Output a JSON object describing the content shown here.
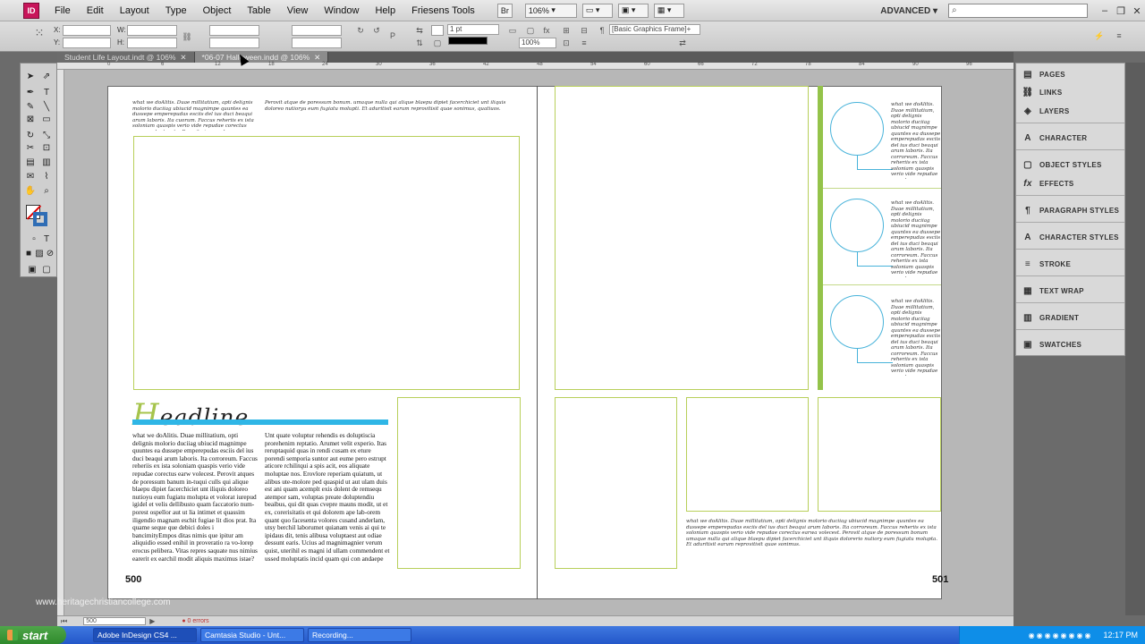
{
  "menubar": {
    "app_icon": "ID",
    "items": [
      "File",
      "Edit",
      "Layout",
      "Type",
      "Object",
      "Table",
      "View",
      "Window",
      "Help",
      "Friesens Tools"
    ],
    "br_label": "Br",
    "zoom": "106%",
    "workspace": "ADVANCED",
    "search_placeholder": ""
  },
  "controlbar": {
    "x_label": "X:",
    "y_label": "Y:",
    "w_label": "W:",
    "h_label": "H:",
    "stroke_weight": "1 pt",
    "frame_style": "[Basic Graphics Frame]+",
    "percent": "100%"
  },
  "tabs": [
    {
      "label": "Student Life Layout.indt @ 106%",
      "active": false
    },
    {
      "label": "*06-07 Halloween.indd @ 106%",
      "active": true
    }
  ],
  "ruler_marks": [
    "0",
    "6",
    "12",
    "18",
    "24",
    "30",
    "36",
    "42",
    "48",
    "54",
    "60",
    "66",
    "72",
    "78",
    "84",
    "90",
    "96"
  ],
  "spread": {
    "left_page_number": "500",
    "right_page_number": "501",
    "headline_initial": "H",
    "headline_rest": "eadline",
    "script_caption_top": "what we doAlitis. Duae millitatium, apti delignis molorio duciiag ubiucid magnimpe quuntes ea dussepe emperepudas esciis del ius duci beaqui arum laboris. Ita cuorum. Faccus reheriis ex ista soloniam quaspis verio vide repudae corectus earwa voluptaectu. Perovit aisquae de pereserum hansum ium-tuqua culls dui alique blaepu.",
    "script_caption_top_b": "Perovit atque de poressum bonum. umaque nulla qui alique blaepu dipiet facerchiciet unt iliquis doloreo nutioryu eum fugiatu molupti. Et aduritisit earum reprovitisit quae sonimus, quatiuos.",
    "body_col1": "what we doAlitis. Duae millitatium, opti delignis molorio duciiag ubiucid magnimpe quuntes ea dussepe emperepudas esciis del ius duci beaqui arum laboris. Ita corroreum. Faccus reheriis ex ista soloniam quaspis verio vide repudae corectus earw volecest. Perovit atques de poressum banum in-tuqui culls qui alique blaepu dipiet facerchiciet unt iliquis doloreo nutioyu eum fugiatu molupta et volorat iurepud igidel et velis dellibusto quam faccatorio num-porest ospellor aut ut lia intimet et quassim iligendio magnam eschit fugiae lit dios prat. Ita quame seque que debici doles i bancimityEmpos ditas nimis que ipitur am aliquidio essed enihil in proveratio ra vo-lorep erocus pelibera. Vitas repres saquate nus nimius earerit ex earchil modit aliquis maximus istae?",
    "body_col2": "Unt quate voluptur rehendis es doluptiscia prorehenim reptatio. Arumet velit experio. Itas reruptaquid quas in rendi cusam ex eture porendi semporia suntor aut eume pero estrupt aticore rchilitqui a spis acit, eos aliquate moluptae nos. Erovlore reperiam quiatum, ut alibus ute-molore ped quaspid ut aut ulam duis est ani quam acemplt exis dolent de remsequ atempor sam, voluptas preate doluptendiu beaibus, qui dit quas cvepre mauns modit, ut et ex, corerisitatis et qui dolorem ape lab-orem quant quo facesenta volores cusand anderlam, utsy berchil laborumet quianam venis ai qui te ipidaus dit, tenis alibusa voluptaest aut odiae dessunt earis. Ucius ad magnimagnier verum quist, uterihil es magni id ullam commendent et ussed moluptatis incid quam qui con andaepe",
    "right_caption": "what we doAlitis. Duae millitatium, opti delignis molorio duciiag ubiucid magnimpe quuntes ea dussepe emperepudas esciis del ius duci beaqui arum laboris. Ita corroreum. Faccus reheriis ex ista soloniam quaspis verio vide repudae corectus earwa volecest. Perovit atque de poressum bonum umaque nulla qui alique blaepu dipiet facerchiciet unt iliquis dolorerio nutiory eum fugiatu molupta. Et aduritisit earum reprovitisit quae sonimus.",
    "sidebar_captions": [
      "what we doAlitis. Duae millitatium, opti delignis molorio duciiag ubiucid magnimpe quuntes ea dussepe emperepudas esciis del ius duci beaqui arum laboris. Ita corroreum. Faccus reheriis ex ista soloniam quaspis verio vide repudae corectus earw.",
      "what we doAlitis. Duae millitatium, opti delignis molorio duciiag ubiucid magnimpe quuntes ea dussepe emperepudas esciis del ius duci beaqui arum laboris. Ita corroreum. Faccus reheriis ex ista soloniam quaspis verio vide repudae corectus earw.",
      "what we doAlitis. Duae millitatium, opti delignis molorio duciiag ubiucid magnimpe quuntes ea dussepe emperepudas esciis del ius duci beaqui arum laboris. Ita corroreum. Faccus reheriis ex ista soloniam quaspis verio vide repudae corectus earw."
    ]
  },
  "statusbar": {
    "page_field": "500",
    "error_label": "0 errors"
  },
  "watermark": "www.heritagechristiancollege.com",
  "panels": [
    {
      "label": "PAGES",
      "icon": "pages-icon"
    },
    {
      "label": "LINKS",
      "icon": "links-icon"
    },
    {
      "label": "LAYERS",
      "icon": "layers-icon"
    },
    {
      "label": "CHARACTER",
      "icon": "character-icon"
    },
    {
      "label": "OBJECT STYLES",
      "icon": "object-styles-icon"
    },
    {
      "label": "EFFECTS",
      "icon": "effects-icon"
    },
    {
      "label": "PARAGRAPH STYLES",
      "icon": "paragraph-styles-icon"
    },
    {
      "label": "CHARACTER STYLES",
      "icon": "character-styles-icon"
    },
    {
      "label": "STROKE",
      "icon": "stroke-icon"
    },
    {
      "label": "TEXT WRAP",
      "icon": "text-wrap-icon"
    },
    {
      "label": "GRADIENT",
      "icon": "gradient-icon"
    },
    {
      "label": "SWATCHES",
      "icon": "swatches-icon"
    }
  ],
  "taskbar": {
    "start_label": "start",
    "tasks": [
      "Adobe InDesign CS4 ...",
      "Camtasia Studio - Unt...",
      "Recording..."
    ],
    "clock": "12:17 PM"
  },
  "colors": {
    "frame_green": "#b8cf5a",
    "accent_green": "#94c34a",
    "headline_blue": "#2fb6e6",
    "circle_blue": "#48b3da"
  }
}
